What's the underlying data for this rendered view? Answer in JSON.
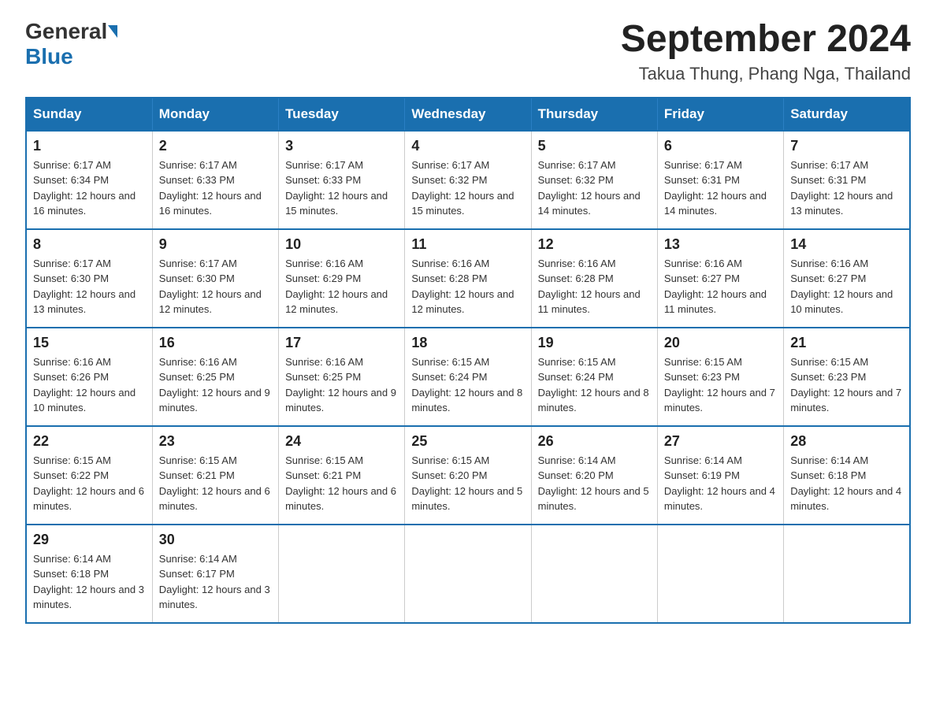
{
  "logo": {
    "general": "General",
    "blue": "Blue"
  },
  "header": {
    "month_year": "September 2024",
    "location": "Takua Thung, Phang Nga, Thailand"
  },
  "days_of_week": [
    "Sunday",
    "Monday",
    "Tuesday",
    "Wednesday",
    "Thursday",
    "Friday",
    "Saturday"
  ],
  "weeks": [
    [
      {
        "day": "1",
        "sunrise": "Sunrise: 6:17 AM",
        "sunset": "Sunset: 6:34 PM",
        "daylight": "Daylight: 12 hours and 16 minutes."
      },
      {
        "day": "2",
        "sunrise": "Sunrise: 6:17 AM",
        "sunset": "Sunset: 6:33 PM",
        "daylight": "Daylight: 12 hours and 16 minutes."
      },
      {
        "day": "3",
        "sunrise": "Sunrise: 6:17 AM",
        "sunset": "Sunset: 6:33 PM",
        "daylight": "Daylight: 12 hours and 15 minutes."
      },
      {
        "day": "4",
        "sunrise": "Sunrise: 6:17 AM",
        "sunset": "Sunset: 6:32 PM",
        "daylight": "Daylight: 12 hours and 15 minutes."
      },
      {
        "day": "5",
        "sunrise": "Sunrise: 6:17 AM",
        "sunset": "Sunset: 6:32 PM",
        "daylight": "Daylight: 12 hours and 14 minutes."
      },
      {
        "day": "6",
        "sunrise": "Sunrise: 6:17 AM",
        "sunset": "Sunset: 6:31 PM",
        "daylight": "Daylight: 12 hours and 14 minutes."
      },
      {
        "day": "7",
        "sunrise": "Sunrise: 6:17 AM",
        "sunset": "Sunset: 6:31 PM",
        "daylight": "Daylight: 12 hours and 13 minutes."
      }
    ],
    [
      {
        "day": "8",
        "sunrise": "Sunrise: 6:17 AM",
        "sunset": "Sunset: 6:30 PM",
        "daylight": "Daylight: 12 hours and 13 minutes."
      },
      {
        "day": "9",
        "sunrise": "Sunrise: 6:17 AM",
        "sunset": "Sunset: 6:30 PM",
        "daylight": "Daylight: 12 hours and 12 minutes."
      },
      {
        "day": "10",
        "sunrise": "Sunrise: 6:16 AM",
        "sunset": "Sunset: 6:29 PM",
        "daylight": "Daylight: 12 hours and 12 minutes."
      },
      {
        "day": "11",
        "sunrise": "Sunrise: 6:16 AM",
        "sunset": "Sunset: 6:28 PM",
        "daylight": "Daylight: 12 hours and 12 minutes."
      },
      {
        "day": "12",
        "sunrise": "Sunrise: 6:16 AM",
        "sunset": "Sunset: 6:28 PM",
        "daylight": "Daylight: 12 hours and 11 minutes."
      },
      {
        "day": "13",
        "sunrise": "Sunrise: 6:16 AM",
        "sunset": "Sunset: 6:27 PM",
        "daylight": "Daylight: 12 hours and 11 minutes."
      },
      {
        "day": "14",
        "sunrise": "Sunrise: 6:16 AM",
        "sunset": "Sunset: 6:27 PM",
        "daylight": "Daylight: 12 hours and 10 minutes."
      }
    ],
    [
      {
        "day": "15",
        "sunrise": "Sunrise: 6:16 AM",
        "sunset": "Sunset: 6:26 PM",
        "daylight": "Daylight: 12 hours and 10 minutes."
      },
      {
        "day": "16",
        "sunrise": "Sunrise: 6:16 AM",
        "sunset": "Sunset: 6:25 PM",
        "daylight": "Daylight: 12 hours and 9 minutes."
      },
      {
        "day": "17",
        "sunrise": "Sunrise: 6:16 AM",
        "sunset": "Sunset: 6:25 PM",
        "daylight": "Daylight: 12 hours and 9 minutes."
      },
      {
        "day": "18",
        "sunrise": "Sunrise: 6:15 AM",
        "sunset": "Sunset: 6:24 PM",
        "daylight": "Daylight: 12 hours and 8 minutes."
      },
      {
        "day": "19",
        "sunrise": "Sunrise: 6:15 AM",
        "sunset": "Sunset: 6:24 PM",
        "daylight": "Daylight: 12 hours and 8 minutes."
      },
      {
        "day": "20",
        "sunrise": "Sunrise: 6:15 AM",
        "sunset": "Sunset: 6:23 PM",
        "daylight": "Daylight: 12 hours and 7 minutes."
      },
      {
        "day": "21",
        "sunrise": "Sunrise: 6:15 AM",
        "sunset": "Sunset: 6:23 PM",
        "daylight": "Daylight: 12 hours and 7 minutes."
      }
    ],
    [
      {
        "day": "22",
        "sunrise": "Sunrise: 6:15 AM",
        "sunset": "Sunset: 6:22 PM",
        "daylight": "Daylight: 12 hours and 6 minutes."
      },
      {
        "day": "23",
        "sunrise": "Sunrise: 6:15 AM",
        "sunset": "Sunset: 6:21 PM",
        "daylight": "Daylight: 12 hours and 6 minutes."
      },
      {
        "day": "24",
        "sunrise": "Sunrise: 6:15 AM",
        "sunset": "Sunset: 6:21 PM",
        "daylight": "Daylight: 12 hours and 6 minutes."
      },
      {
        "day": "25",
        "sunrise": "Sunrise: 6:15 AM",
        "sunset": "Sunset: 6:20 PM",
        "daylight": "Daylight: 12 hours and 5 minutes."
      },
      {
        "day": "26",
        "sunrise": "Sunrise: 6:14 AM",
        "sunset": "Sunset: 6:20 PM",
        "daylight": "Daylight: 12 hours and 5 minutes."
      },
      {
        "day": "27",
        "sunrise": "Sunrise: 6:14 AM",
        "sunset": "Sunset: 6:19 PM",
        "daylight": "Daylight: 12 hours and 4 minutes."
      },
      {
        "day": "28",
        "sunrise": "Sunrise: 6:14 AM",
        "sunset": "Sunset: 6:18 PM",
        "daylight": "Daylight: 12 hours and 4 minutes."
      }
    ],
    [
      {
        "day": "29",
        "sunrise": "Sunrise: 6:14 AM",
        "sunset": "Sunset: 6:18 PM",
        "daylight": "Daylight: 12 hours and 3 minutes."
      },
      {
        "day": "30",
        "sunrise": "Sunrise: 6:14 AM",
        "sunset": "Sunset: 6:17 PM",
        "daylight": "Daylight: 12 hours and 3 minutes."
      },
      null,
      null,
      null,
      null,
      null
    ]
  ]
}
